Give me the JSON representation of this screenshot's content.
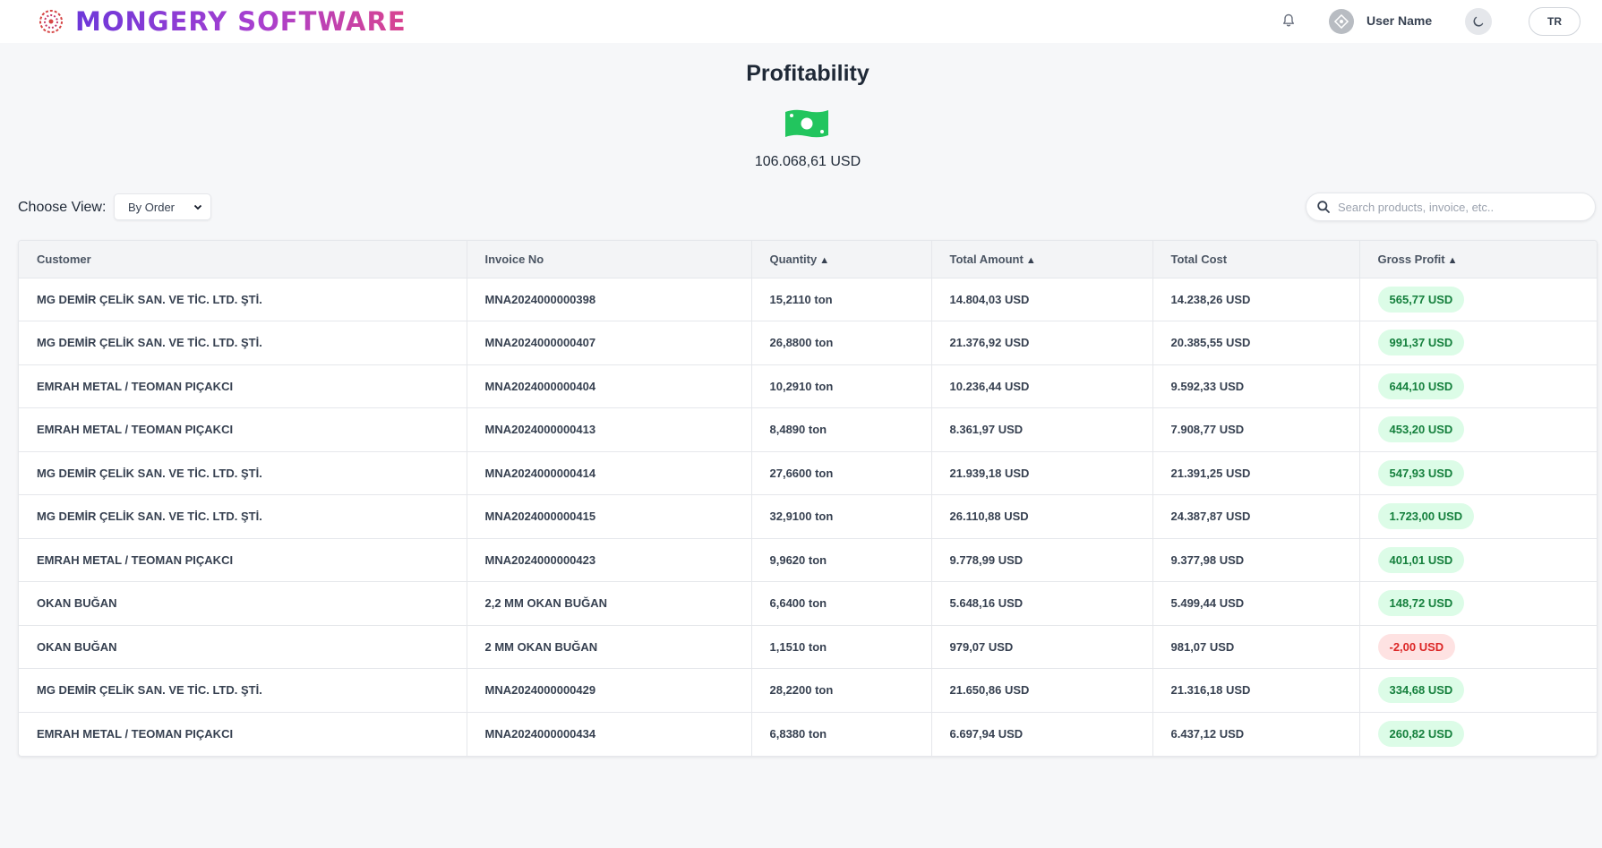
{
  "app": {
    "brand_name": "MONGERY SOFTWARE",
    "user_name": "User Name",
    "language": "TR"
  },
  "summary": {
    "title": "Profitability",
    "total_value": "106.068,61 USD",
    "icon": "money-bill-icon"
  },
  "controls": {
    "view_label": "Choose View:",
    "view_selected": "By Order",
    "search_placeholder": "Search products, invoice, etc.."
  },
  "colors": {
    "brand_start": "#6d38d9",
    "brand_end": "#d9448f",
    "profit_positive_bg": "#dcfce7",
    "profit_positive_text": "#15803d",
    "profit_negative_bg": "#fee2e2",
    "profit_negative_text": "#dc2626",
    "money_icon": "#22c55e"
  },
  "table": {
    "columns": [
      {
        "label": "Customer",
        "sortable": false
      },
      {
        "label": "Invoice No",
        "sortable": false
      },
      {
        "label": "Quantity",
        "sortable": true
      },
      {
        "label": "Total Amount",
        "sortable": true
      },
      {
        "label": "Total Cost",
        "sortable": false
      },
      {
        "label": "Gross Profit",
        "sortable": true
      }
    ],
    "rows": [
      {
        "customer": "MG DEMİR ÇELİK SAN. VE TİC. LTD. ŞTİ.",
        "invoice": "MNA2024000000398",
        "quantity": "15,2110 ton",
        "total_amount": "14.804,03 USD",
        "total_cost": "14.238,26 USD",
        "gross_profit": "565,77 USD",
        "negative": false
      },
      {
        "customer": "MG DEMİR ÇELİK SAN. VE TİC. LTD. ŞTİ.",
        "invoice": "MNA2024000000407",
        "quantity": "26,8800 ton",
        "total_amount": "21.376,92 USD",
        "total_cost": "20.385,55 USD",
        "gross_profit": "991,37 USD",
        "negative": false
      },
      {
        "customer": "EMRAH METAL / TEOMAN PIÇAKCI",
        "invoice": "MNA2024000000404",
        "quantity": "10,2910 ton",
        "total_amount": "10.236,44 USD",
        "total_cost": "9.592,33 USD",
        "gross_profit": "644,10 USD",
        "negative": false
      },
      {
        "customer": "EMRAH METAL / TEOMAN PIÇAKCI",
        "invoice": "MNA2024000000413",
        "quantity": "8,4890 ton",
        "total_amount": "8.361,97 USD",
        "total_cost": "7.908,77 USD",
        "gross_profit": "453,20 USD",
        "negative": false
      },
      {
        "customer": "MG DEMİR ÇELİK SAN. VE TİC. LTD. ŞTİ.",
        "invoice": "MNA2024000000414",
        "quantity": "27,6600 ton",
        "total_amount": "21.939,18 USD",
        "total_cost": "21.391,25 USD",
        "gross_profit": "547,93 USD",
        "negative": false
      },
      {
        "customer": "MG DEMİR ÇELİK SAN. VE TİC. LTD. ŞTİ.",
        "invoice": "MNA2024000000415",
        "quantity": "32,9100 ton",
        "total_amount": "26.110,88 USD",
        "total_cost": "24.387,87 USD",
        "gross_profit": "1.723,00 USD",
        "negative": false
      },
      {
        "customer": "EMRAH METAL / TEOMAN PIÇAKCI",
        "invoice": "MNA2024000000423",
        "quantity": "9,9620 ton",
        "total_amount": "9.778,99 USD",
        "total_cost": "9.377,98 USD",
        "gross_profit": "401,01 USD",
        "negative": false
      },
      {
        "customer": "OKAN BUĞAN",
        "invoice": "2,2 MM OKAN BUĞAN",
        "quantity": "6,6400 ton",
        "total_amount": "5.648,16 USD",
        "total_cost": "5.499,44 USD",
        "gross_profit": "148,72 USD",
        "negative": false
      },
      {
        "customer": "OKAN BUĞAN",
        "invoice": "2 MM OKAN BUĞAN",
        "quantity": "1,1510 ton",
        "total_amount": "979,07 USD",
        "total_cost": "981,07 USD",
        "gross_profit": "-2,00 USD",
        "negative": true
      },
      {
        "customer": "MG DEMİR ÇELİK SAN. VE TİC. LTD. ŞTİ.",
        "invoice": "MNA2024000000429",
        "quantity": "28,2200 ton",
        "total_amount": "21.650,86 USD",
        "total_cost": "21.316,18 USD",
        "gross_profit": "334,68 USD",
        "negative": false
      },
      {
        "customer": "EMRAH METAL / TEOMAN PIÇAKCI",
        "invoice": "MNA2024000000434",
        "quantity": "6,8380 ton",
        "total_amount": "6.697,94 USD",
        "total_cost": "6.437,12 USD",
        "gross_profit": "260,82 USD",
        "negative": false
      }
    ]
  }
}
